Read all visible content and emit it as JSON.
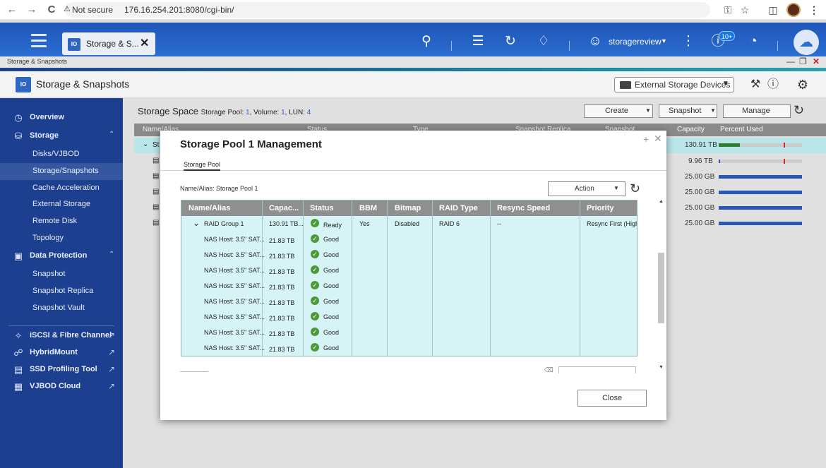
{
  "browser": {
    "back": "←",
    "forward": "→",
    "reload": "C",
    "not_secure": "Not secure",
    "url": "176.16.254.201:8080/cgi-bin/"
  },
  "topbar": {
    "app_tab_label": "Storage & S...",
    "app_tab_icon_text": "IO",
    "user_name": "storagereview",
    "notification_badge": "10+"
  },
  "window": {
    "strip_title": "Storage & Snapshots",
    "app_title": "Storage & Snapshots",
    "external_storage_button": "External Storage Devices"
  },
  "sidebar": {
    "items": [
      {
        "label": "Overview"
      },
      {
        "label": "Storage"
      },
      {
        "label": "Disks/VJBOD"
      },
      {
        "label": "Storage/Snapshots"
      },
      {
        "label": "Cache Acceleration"
      },
      {
        "label": "External Storage"
      },
      {
        "label": "Remote Disk"
      },
      {
        "label": "Topology"
      },
      {
        "label": "Data Protection"
      },
      {
        "label": "Snapshot"
      },
      {
        "label": "Snapshot Replica"
      },
      {
        "label": "Snapshot Vault"
      },
      {
        "label": "iSCSI & Fibre Channel"
      },
      {
        "label": "HybridMount"
      },
      {
        "label": "SSD Profiling Tool"
      },
      {
        "label": "VJBOD Cloud"
      }
    ]
  },
  "main": {
    "storage_space": "Storage Space",
    "summary_prefix": "Storage Pool:",
    "pool_count": "1",
    "volume_label": ", Volume:",
    "volume_count": "1",
    "lun_label": ", LUN:",
    "lun_count": "4",
    "create_button": "Create",
    "snapshot_button": "Snapshot",
    "manage_button": "Manage",
    "columns": [
      "Name/Alias",
      "Status",
      "Type",
      "Snapshot Replica",
      "Snapshot",
      "Capacity",
      "Percent Used"
    ],
    "row_prefix": "St",
    "rows": [
      {
        "capacity": "130.91 TB"
      },
      {
        "capacity": "9.96 TB"
      },
      {
        "capacity": "25.00 GB"
      },
      {
        "capacity": "25.00 GB"
      },
      {
        "capacity": "25.00 GB"
      },
      {
        "capacity": "25.00 GB"
      }
    ]
  },
  "modal": {
    "title": "Storage Pool 1 Management",
    "tab": "Storage Pool",
    "name_alias": "Name/Alias: Storage Pool 1",
    "action_button": "Action",
    "close_button": "Close",
    "columns": [
      "Name/Alias",
      "Capac...",
      "Status",
      "BBM",
      "Bitmap",
      "RAID Type",
      "Resync Speed",
      "Priority"
    ],
    "group": {
      "name": "RAID Group 1",
      "capacity": "130.91 TB...",
      "status": "Ready",
      "bbm": "Yes",
      "bitmap": "Disabled",
      "raid_type": "RAID 6",
      "resync_speed": "--",
      "priority": "Resync First (High"
    },
    "disks": [
      {
        "name": "NAS Host: 3.5\" SAT...",
        "capacity": "21.83 TB",
        "status": "Good"
      },
      {
        "name": "NAS Host: 3.5\" SAT...",
        "capacity": "21.83 TB",
        "status": "Good"
      },
      {
        "name": "NAS Host: 3.5\" SAT...",
        "capacity": "21.83 TB",
        "status": "Good"
      },
      {
        "name": "NAS Host: 3.5\" SAT...",
        "capacity": "21.83 TB",
        "status": "Good"
      },
      {
        "name": "NAS Host: 3.5\" SAT...",
        "capacity": "21.83 TB",
        "status": "Good"
      },
      {
        "name": "NAS Host: 3.5\" SAT...",
        "capacity": "21.83 TB",
        "status": "Good"
      },
      {
        "name": "NAS Host: 3.5\" SAT...",
        "capacity": "21.83 TB",
        "status": "Good"
      },
      {
        "name": "NAS Host: 3.5\" SAT...",
        "capacity": "21.83 TB",
        "status": "Good"
      }
    ]
  }
}
